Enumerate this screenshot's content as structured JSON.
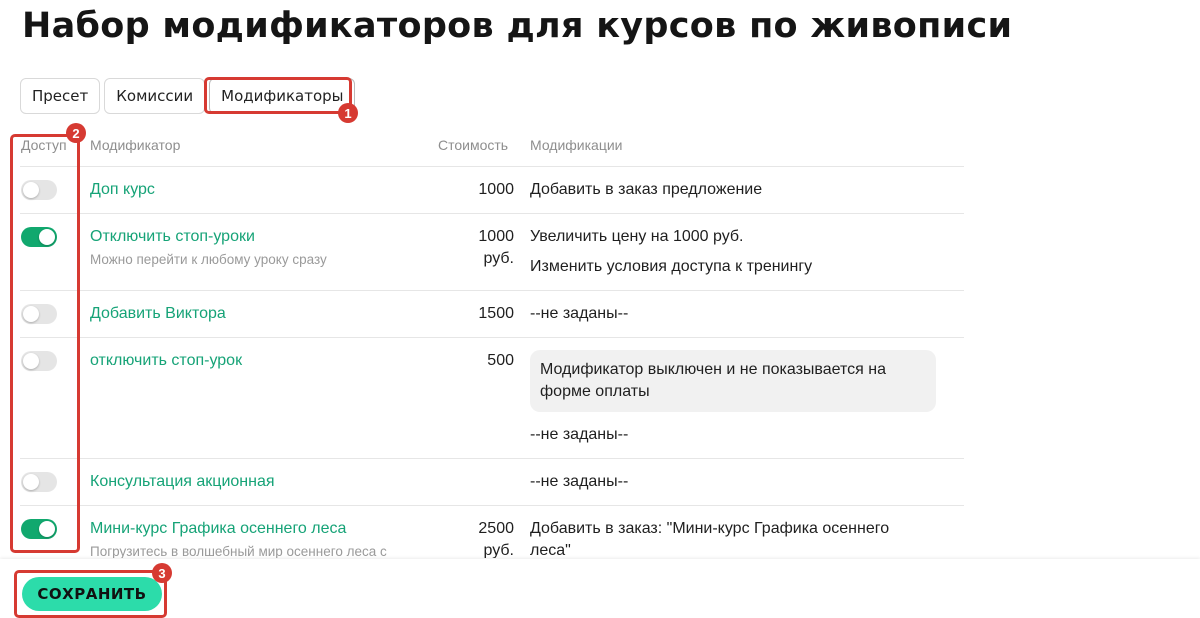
{
  "page": {
    "title": "Набор модификаторов для курсов по живописи"
  },
  "tabs": [
    {
      "label": "Пресет",
      "active": false
    },
    {
      "label": "Комиссии",
      "active": false
    },
    {
      "label": "Модификаторы",
      "active": true
    }
  ],
  "table": {
    "headers": {
      "access": "Доступ",
      "modifier": "Модификатор",
      "cost": "Стоимость",
      "modifications": "Модификации"
    },
    "rows": [
      {
        "enabled": false,
        "name": "Доп курс",
        "cost": "1000",
        "modifications": [
          "Добавить в заказ предложение"
        ]
      },
      {
        "enabled": true,
        "name": "Отключить стоп-уроки",
        "subtitle": "Можно перейти к любому уроку сразу",
        "cost_lines": [
          "1000",
          "руб."
        ],
        "modifications": [
          "Увеличить цену на 1000 руб.",
          "Изменить условия доступа к тренингу"
        ]
      },
      {
        "enabled": false,
        "name": "Добавить Виктора",
        "cost": "1500",
        "modifications": [
          "--не заданы--"
        ]
      },
      {
        "enabled": false,
        "name": "отключить стоп-урок",
        "cost": "500",
        "notice": "Модификатор выключен и не показывается на форме оплаты",
        "modifications": [
          "--не заданы--"
        ]
      },
      {
        "enabled": false,
        "name": "Консультация акционная",
        "cost": "",
        "modifications": [
          "--не заданы--"
        ]
      },
      {
        "enabled": true,
        "name": "Мини-курс Графика осеннего леса",
        "subtitle": "Погрузитесь в волшебный мир осеннего леса с",
        "cost_lines": [
          "2500",
          "руб."
        ],
        "modifications": [
          "Добавить в заказ: \"Мини-курс Графика осеннего",
          "леса\""
        ]
      }
    ]
  },
  "footer": {
    "save_label": "СОХРАНИТЬ"
  },
  "annotations": {
    "tabs_badge": "1",
    "access_badge": "2",
    "save_badge": "3"
  },
  "colors": {
    "accent_green": "#16a377",
    "toggle_on": "#11a86e",
    "save_button": "#2cdcaa",
    "annotation_red": "#d63a32"
  }
}
